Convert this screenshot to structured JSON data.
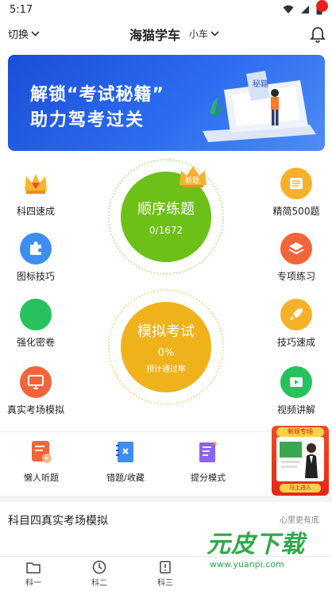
{
  "status": {
    "time": "5:17"
  },
  "header": {
    "switch_label": "切换",
    "title": "海猫学车",
    "car_type": "小车"
  },
  "banner": {
    "line1": "解锁“考试秘籍”",
    "line2": "助力驾考过关",
    "book_text": "秘籍"
  },
  "features_left": [
    {
      "label": "科四速成",
      "icon": "crown-icon",
      "color": "#f5a623"
    },
    {
      "label": "图标技巧",
      "icon": "puzzle-icon",
      "color": "#3d8ef0"
    },
    {
      "label": "强化密卷",
      "icon": "circle-icon",
      "color": "#27c15e"
    },
    {
      "label": "真实考场模拟",
      "icon": "monitor-icon",
      "color": "#f2643a"
    }
  ],
  "features_right": [
    {
      "label": "精简500题",
      "icon": "list-icon",
      "color": "#f6b12a"
    },
    {
      "label": "专项练习",
      "icon": "layers-icon",
      "color": "#f2643a"
    },
    {
      "label": "技巧速成",
      "icon": "rocket-icon",
      "color": "#f6b12a"
    },
    {
      "label": "视频讲解",
      "icon": "video-icon",
      "color": "#27c15e"
    }
  ],
  "practice": {
    "title": "顺序练题",
    "progress": "0/1672",
    "badge": "新题",
    "color": "#6cc018"
  },
  "exam": {
    "title": "模拟考试",
    "pass_rate": "0%",
    "pass_label": "预计通过率",
    "color": "#f0b21a"
  },
  "tools": [
    {
      "label": "懒人听题",
      "icon": "headphone-doc-icon"
    },
    {
      "label": "错题/收藏",
      "icon": "wrongbook-icon"
    },
    {
      "label": "提分模式",
      "icon": "score-up-icon"
    }
  ],
  "promo": {
    "tag": "新规专场",
    "button": "马上进入"
  },
  "section": {
    "title": "科目四真实考场模拟",
    "right_text": "心里更有底"
  },
  "tabs": [
    {
      "label": "科一",
      "icon": "folder-icon"
    },
    {
      "label": "科二",
      "icon": "clock-icon"
    },
    {
      "label": "科三",
      "icon": "warning-icon"
    }
  ],
  "watermark": {
    "main": "元皮下载",
    "url": "www.yuanpi.com"
  }
}
